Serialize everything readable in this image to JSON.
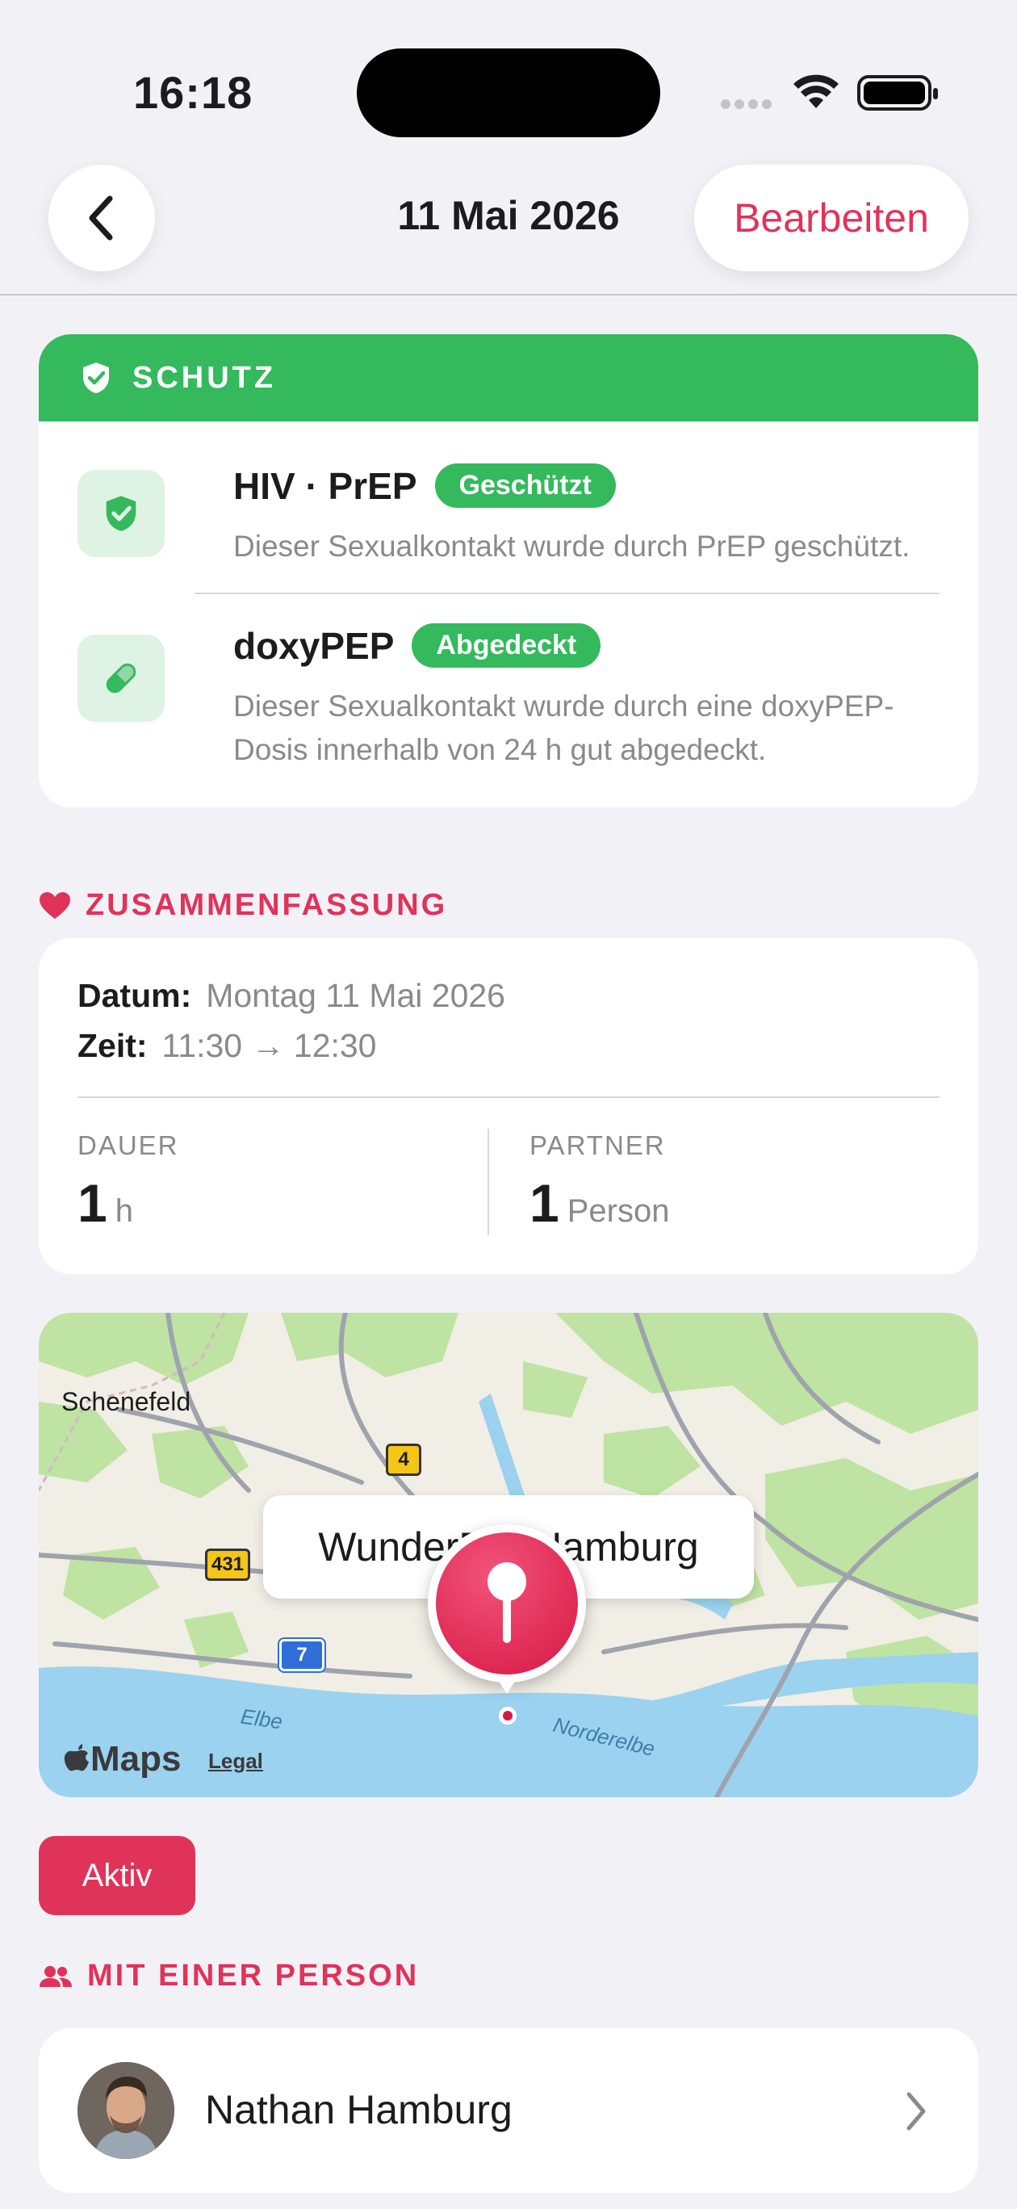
{
  "status_bar": {
    "time": "16:18"
  },
  "nav": {
    "title": "11 Mai 2026",
    "edit_label": "Bearbeiten"
  },
  "schutz": {
    "header": "SCHUTZ",
    "items": [
      {
        "title": "HIV · PrEP",
        "badge": "Geschützt",
        "description": "Dieser Sexualkontakt wurde durch PrEP geschützt.",
        "icon": "shield-check-icon"
      },
      {
        "title": "doxyPEP",
        "badge": "Abgedeckt",
        "description_lines": [
          "Dieser Sexualkontakt wurde durch eine doxyPEP-",
          "Dosis innerhalb von 24 h gut abgedeckt."
        ],
        "icon": "pill-icon"
      }
    ]
  },
  "summary": {
    "section_label": "ZUSAMMENFASSUNG",
    "date_label": "Datum:",
    "date_value": "Montag 11 Mai 2026",
    "time_label": "Zeit:",
    "time_value": "11:30 → 12:30",
    "duration_label": "DAUER",
    "duration_value": "1",
    "duration_unit": "h",
    "partner_label": "PARTNER",
    "partner_value": "1",
    "partner_unit": "Person"
  },
  "map": {
    "callout": "WunderBar Hamburg",
    "place_label": "Schenefeld",
    "river_1": "Elbe",
    "river_2": "Norderelbe",
    "shield_1": "4",
    "shield_2": "431",
    "shield_3": "7",
    "maps_label": "Maps",
    "legal_label": "Legal"
  },
  "status_button": "Aktiv",
  "partners": {
    "section_label": "MIT EINER PERSON",
    "items": [
      {
        "name": "Nathan Hamburg"
      }
    ]
  },
  "colors": {
    "accent": "#e0335a",
    "green": "#34b95c",
    "background": "#f2f1f6"
  }
}
